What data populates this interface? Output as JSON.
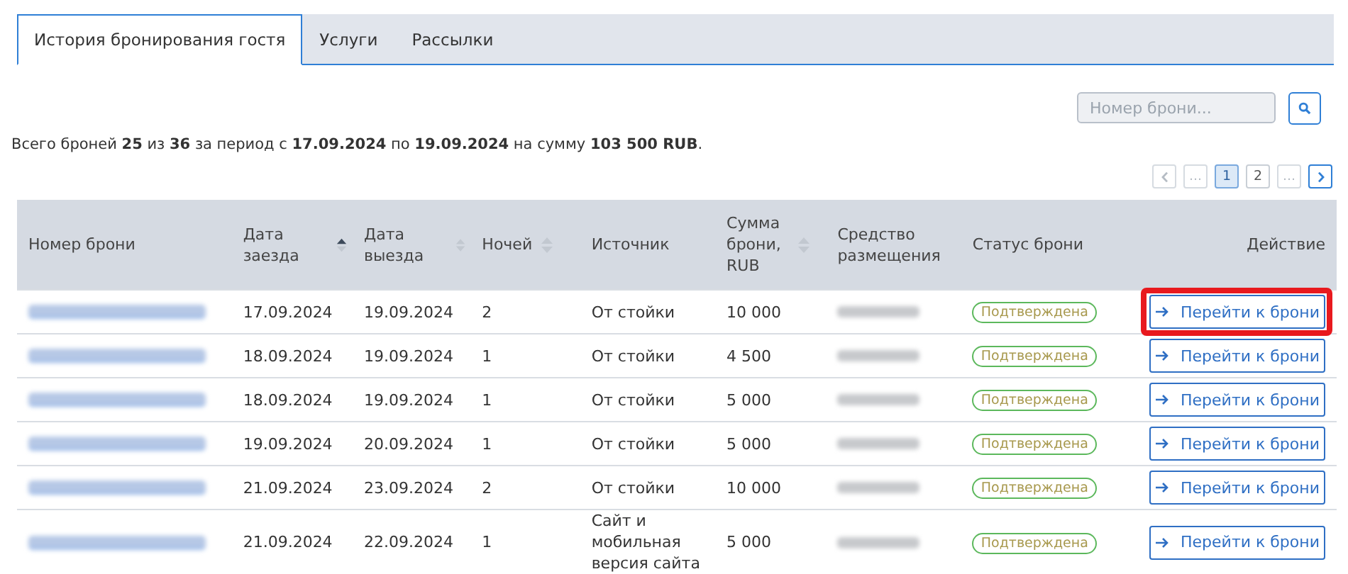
{
  "tabs": [
    {
      "label": "История бронирования гостя",
      "selected": true
    },
    {
      "label": "Услуги",
      "selected": false
    },
    {
      "label": "Рассылки",
      "selected": false
    }
  ],
  "search": {
    "placeholder": "Номер брони..."
  },
  "summary": "Всего броней **25** из **36** за период с **17.09.2024** по **19.09.2024** на сумму **103 500 RUB**.",
  "pagination": [
    {
      "kind": "prev",
      "disabled": true,
      "selected": false
    },
    {
      "kind": "gap",
      "label": "...",
      "disabled": true,
      "selected": false
    },
    {
      "kind": "page",
      "label": "1",
      "selected": true
    },
    {
      "kind": "page",
      "label": "2",
      "selected": false
    },
    {
      "kind": "gap",
      "label": "...",
      "disabled": true,
      "selected": false
    },
    {
      "kind": "next",
      "disabled": false,
      "selected": false
    }
  ],
  "table": {
    "columns": [
      {
        "label": "Номер брони"
      },
      {
        "label": "Дата заезда",
        "sortable": true,
        "sorted": true
      },
      {
        "label": "Дата выезда",
        "sortable": true,
        "sorted": false
      },
      {
        "label": "Ночей",
        "sortable": true,
        "sorted": false
      },
      {
        "label": "Источник"
      },
      {
        "label": "Сумма брони, RUB",
        "sortable": true,
        "sorted": false
      },
      {
        "label": "Средство размещения"
      },
      {
        "label": "Статус брони"
      },
      {
        "label": "Действие"
      }
    ],
    "rows": [
      {
        "check_in": "17.09.2024",
        "check_out": "19.09.2024",
        "nights": "2",
        "source": "От стойки",
        "amount": "10 000",
        "status": "Подтверждена",
        "action": "Перейти к брони",
        "highlighted": true
      },
      {
        "check_in": "18.09.2024",
        "check_out": "19.09.2024",
        "nights": "1",
        "source": "От стойки",
        "amount": "4 500",
        "status": "Подтверждена",
        "action": "Перейти к брони",
        "highlighted": false
      },
      {
        "check_in": "18.09.2024",
        "check_out": "19.09.2024",
        "nights": "1",
        "source": "От стойки",
        "amount": "5 000",
        "status": "Подтверждена",
        "action": "Перейти к брони",
        "highlighted": false
      },
      {
        "check_in": "19.09.2024",
        "check_out": "20.09.2024",
        "nights": "1",
        "source": "От стойки",
        "amount": "5 000",
        "status": "Подтверждена",
        "action": "Перейти к брони",
        "highlighted": false
      },
      {
        "check_in": "21.09.2024",
        "check_out": "23.09.2024",
        "nights": "2",
        "source": "От стойки",
        "amount": "10 000",
        "status": "Подтверждена",
        "action": "Перейти к брони",
        "highlighted": false
      },
      {
        "check_in": "21.09.2024",
        "check_out": "22.09.2024",
        "nights": "1",
        "source": "Сайт и мобильная версия сайта",
        "amount": "5 000",
        "status": "Подтверждена",
        "action": "Перейти к брони",
        "highlighted": false
      }
    ]
  }
}
